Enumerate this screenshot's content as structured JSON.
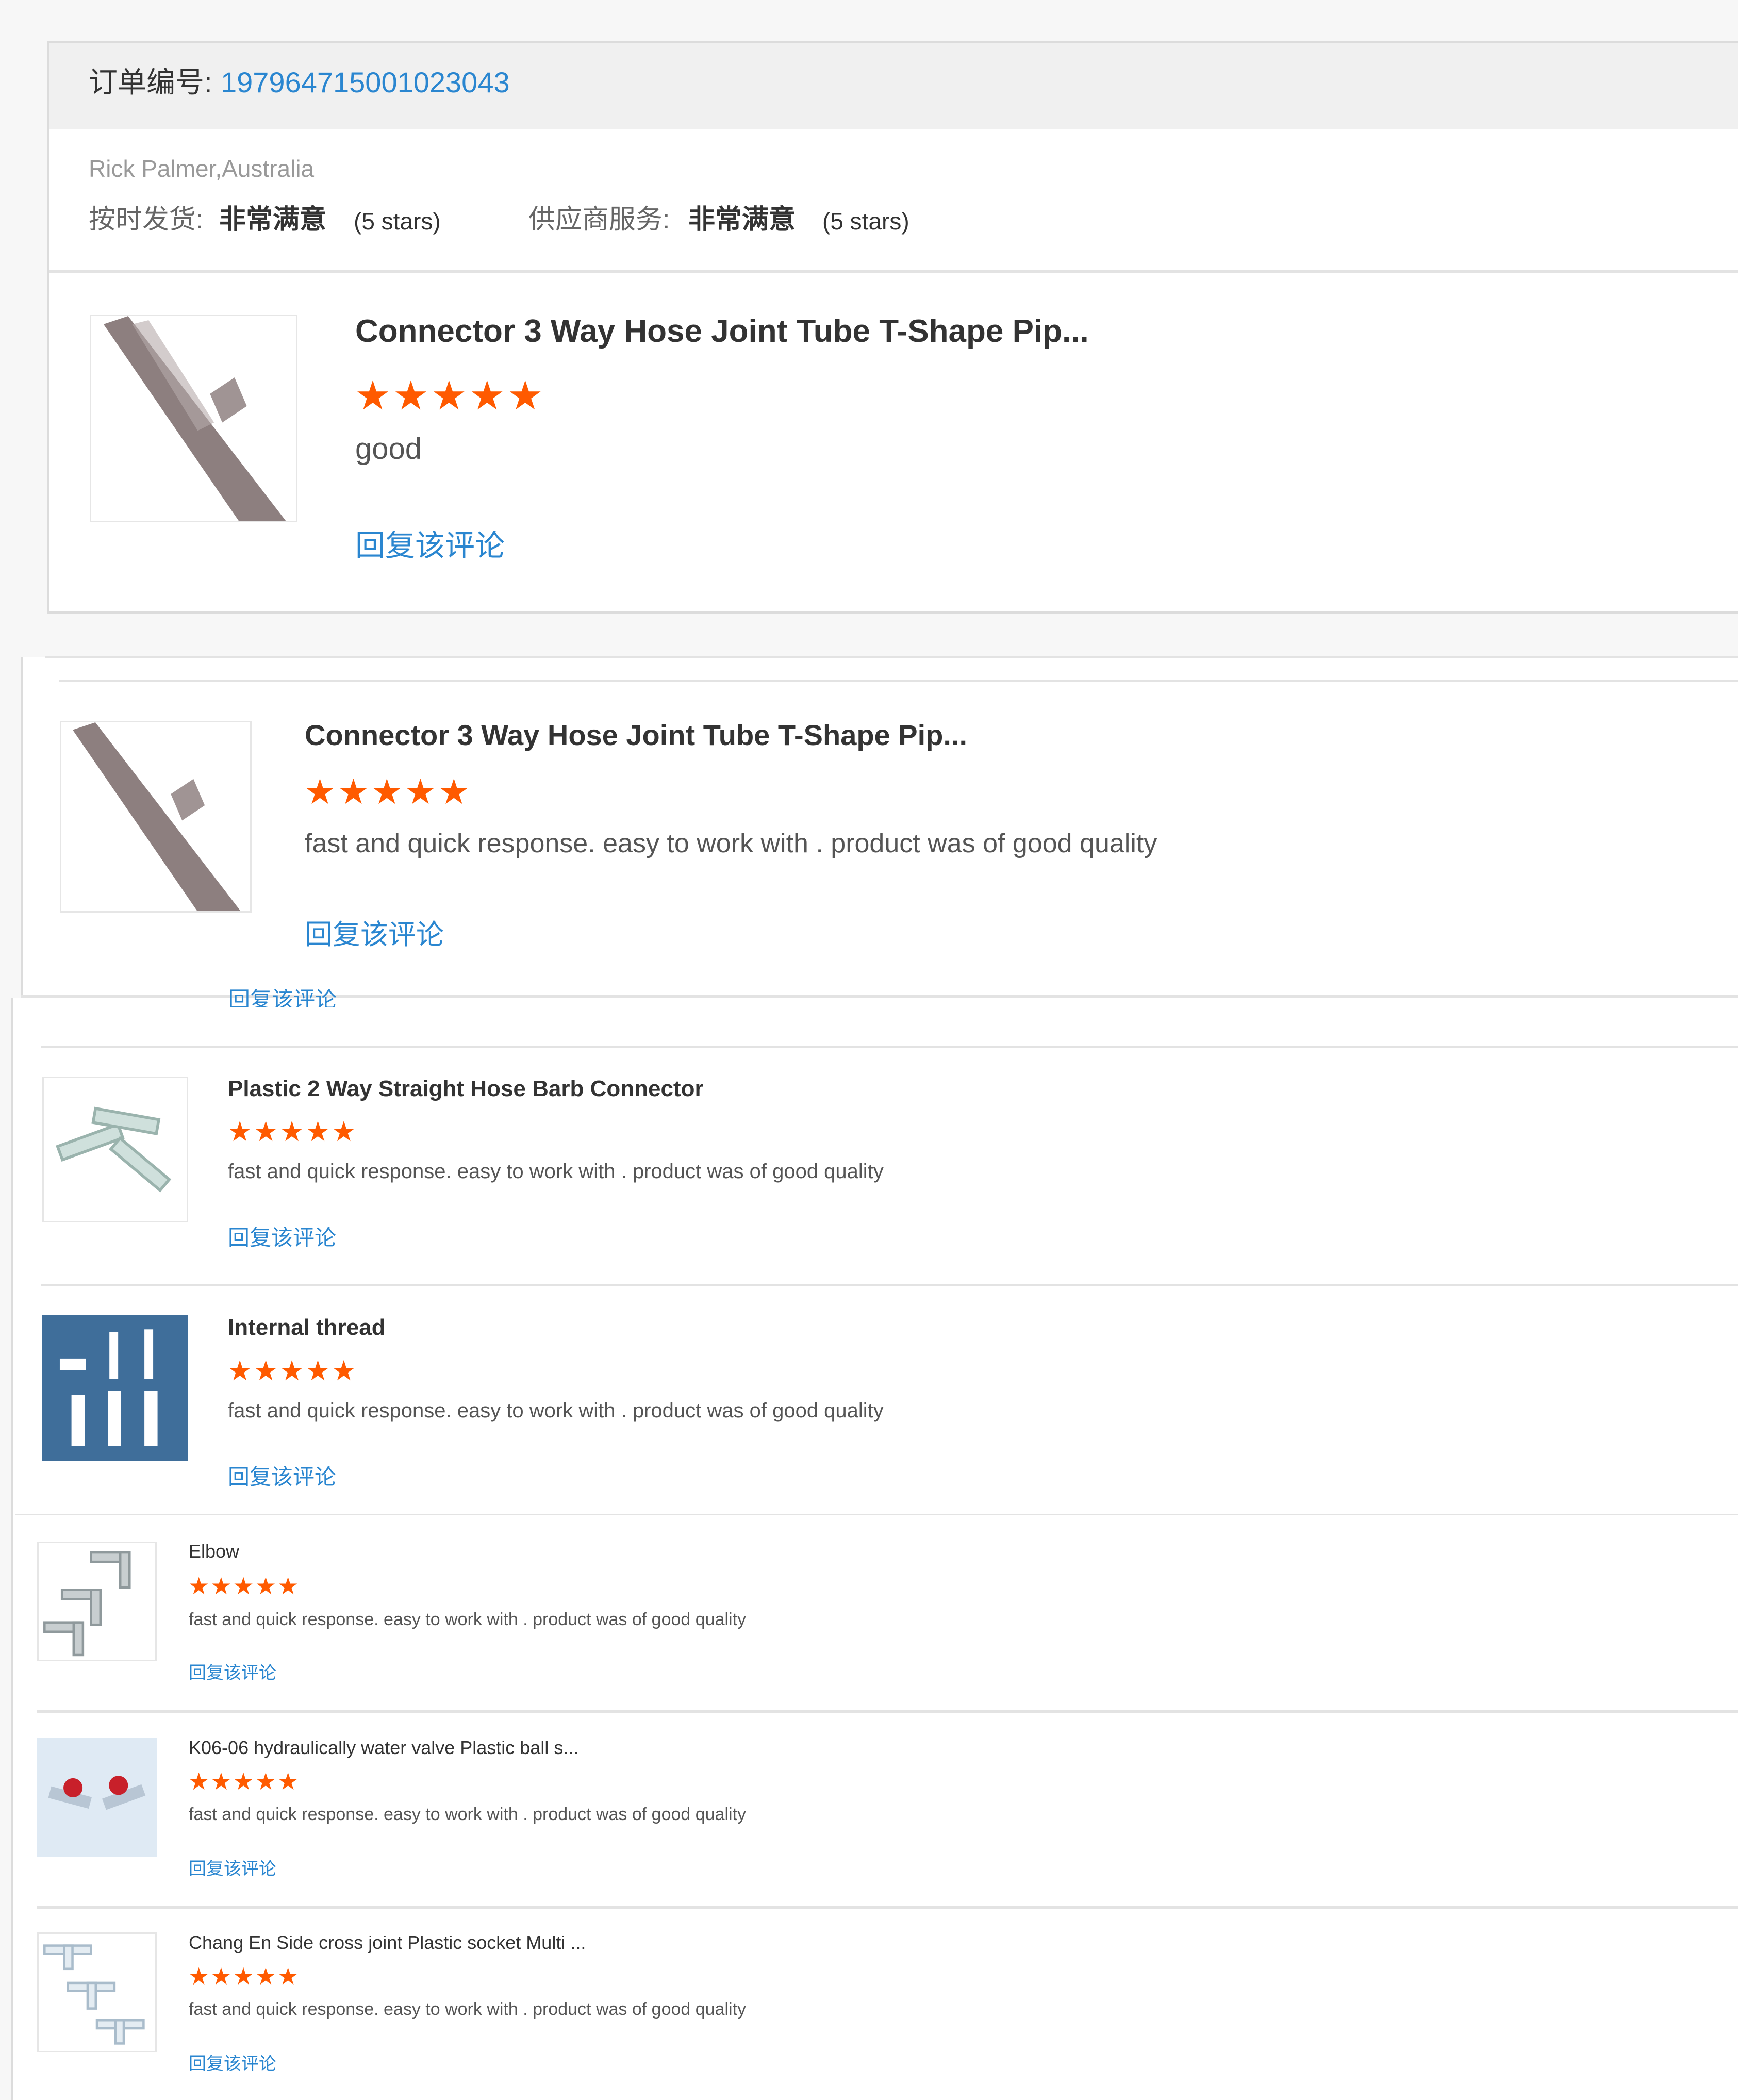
{
  "order": {
    "label": "订单编号:",
    "number": "1979647150010230​43",
    "buyer": "Rick Palmer,Australia",
    "ratings": [
      {
        "label": "按时发货:",
        "value": "非常满意",
        "stars": "(5 stars)"
      },
      {
        "label": "供应商服务:",
        "value": "非常满意",
        "stars": "(5 stars)"
      }
    ]
  },
  "reviews": [
    {
      "title": "Connector 3 Way Hose Joint Tube T-Shape Pip...",
      "rating": 5,
      "stars": "★★★★★",
      "comment": "good",
      "reply": "回复该评论",
      "image_icon": "connector-image"
    },
    {
      "title": "Connector 3 Way Hose Joint Tube T-Shape Pip...",
      "rating": 5,
      "stars": "★★★★★",
      "comment": "fast and quick response. easy to work with . product was of good quality",
      "reply": "回复该评论",
      "image_icon": "connector-image"
    },
    {
      "title": "Plastic 2 Way Straight Hose Barb Connector",
      "rating": 5,
      "stars": "★★★★★",
      "comment": "fast and quick response. easy to work with . product was of good quality",
      "reply": "回复该评论",
      "image_icon": "straight-connector-image"
    },
    {
      "title": "Internal thread",
      "rating": 5,
      "stars": "★★★★★",
      "comment": "fast and quick response. easy to work with . product was of good quality",
      "reply": "回复该评论",
      "image_icon": "internal-thread-image"
    },
    {
      "title": "Elbow",
      "rating": 5,
      "stars": "★★★★★",
      "comment": "fast and quick response. easy to work with . product was of good quality",
      "reply": "回复该评论",
      "image_icon": "elbow-image"
    },
    {
      "title": "K06-06 hydraulically water valve Plastic ball s...",
      "rating": 5,
      "stars": "★★★★★",
      "comment": "fast and quick response. easy to work with . product was of good quality",
      "reply": "回复该评论",
      "image_icon": "ball-valve-image"
    },
    {
      "title": "Chang En Side cross joint Plastic socket Multi ...",
      "rating": 5,
      "stars": "★★★★★",
      "comment": "fast and quick response. easy to work with . product was of good quality",
      "reply": "回复该评论",
      "image_icon": "cross-joint-image"
    }
  ],
  "fragment_reply": "回复该评论",
  "colors": {
    "link": "#2a86d0",
    "star": "#ff5a00",
    "header_bg": "#f0f0f0"
  }
}
